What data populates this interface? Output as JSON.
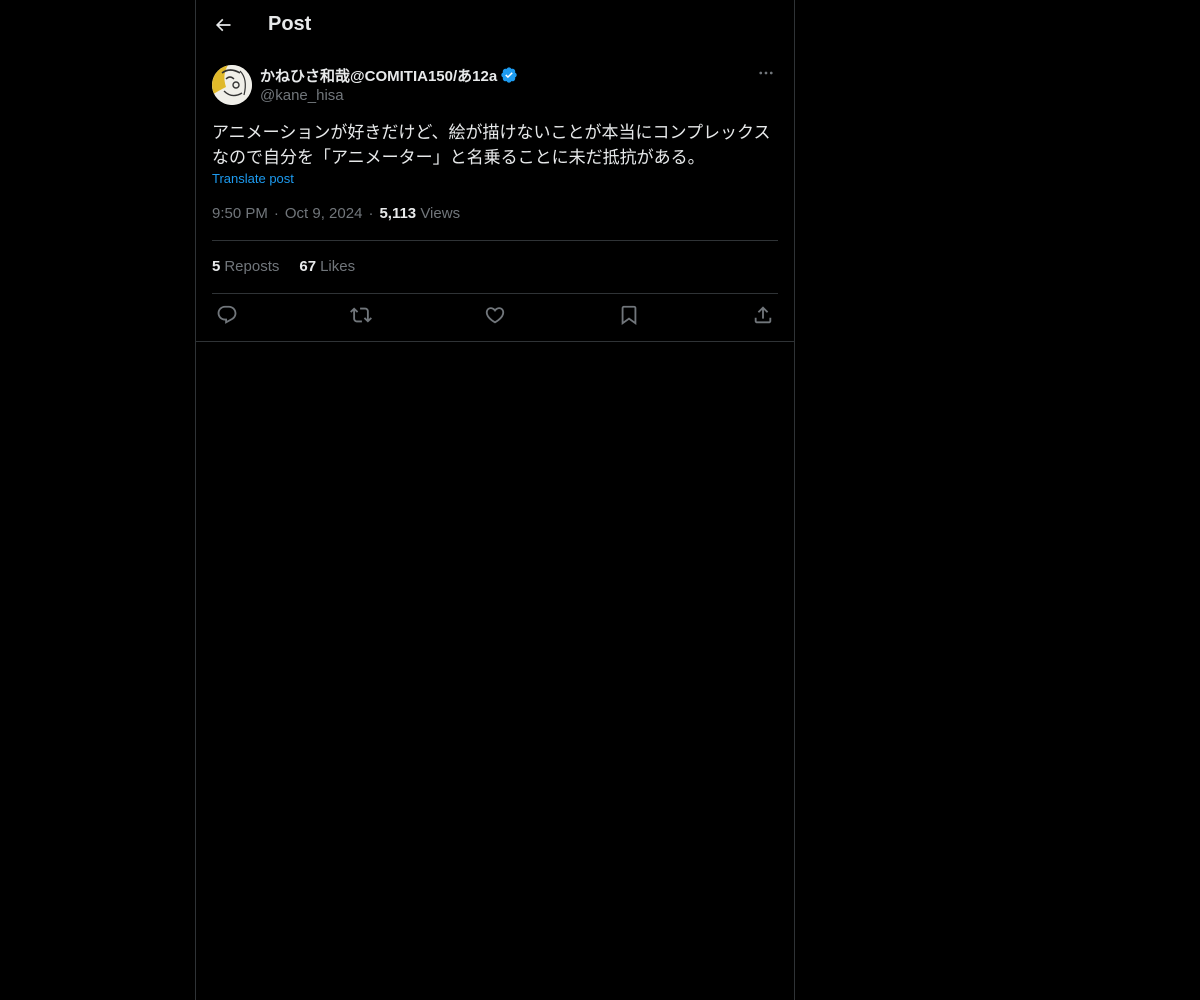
{
  "header": {
    "back_icon": "arrow-left-icon",
    "title": "Post"
  },
  "post": {
    "author": {
      "display_name": "かねひさ和哉@COMITIA150/あ12a",
      "handle": "@kane_hisa",
      "verified": true,
      "verified_color": "#1d9bf0"
    },
    "more_icon": "more-horizontal-icon",
    "text_line1": "アニメーションが好きだけど、絵が描けないことが本当にコンプレックス",
    "text_line2": "なので自分を「アニメーター」と名乗ることに未だ抵抗がある。",
    "translate_label": "Translate post",
    "time": "9:50 PM",
    "date": "Oct 9, 2024",
    "views_count": "5,113",
    "views_label": "Views",
    "reposts_count": "5",
    "reposts_label": "Reposts",
    "likes_count": "67",
    "likes_label": "Likes",
    "actions": [
      "reply-icon",
      "repost-icon",
      "like-icon",
      "bookmark-icon",
      "share-icon"
    ]
  },
  "colors": {
    "background": "#000000",
    "text": "#e7e9ea",
    "secondary": "#71767b",
    "accent": "#1d9bf0",
    "border": "#2f3336"
  }
}
